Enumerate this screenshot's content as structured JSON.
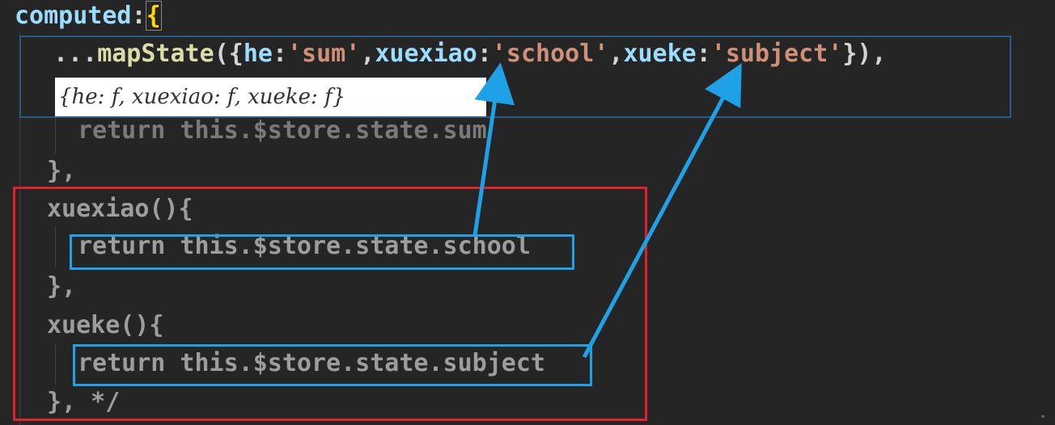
{
  "editor": {
    "lines": {
      "l1_key": "computed",
      "l1_colon": ":",
      "l1_brace": "{",
      "l2_spread": "...",
      "l2_fn": "mapState",
      "l2_open": "({",
      "l2_k1": "he",
      "l2_c1": ":",
      "l2_v1": "'sum'",
      "l2_sep1": ",",
      "l2_k2": "xuexiao",
      "l2_c2": ":",
      "l2_v2": "'school'",
      "l2_sep2": ",",
      "l2_k3": "xueke",
      "l2_c3": ":",
      "l2_v3": "'subject'",
      "l2_close": "}),",
      "l4": "return this.$store.state.sum",
      "l5": "},",
      "l6": "xuexiao(){",
      "l7": "return this.$store.state.school",
      "l8": "},",
      "l9": "xueke(){",
      "l10": "return this.$store.state.subject",
      "l11": "}, */"
    },
    "hint_text": "{he: f, xuexiao: f, xueke: f}"
  },
  "annotation_colors": {
    "blue_arrow": "#1ea1e6",
    "red_box": "#e0202a",
    "dark_blue_box": "#2a5a8a"
  },
  "corner_mark": "\""
}
